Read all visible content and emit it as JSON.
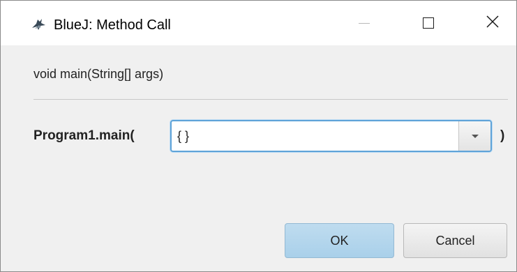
{
  "window": {
    "title": "BlueJ:  Method Call",
    "app_icon": "bluej-bird-icon",
    "controls": {
      "minimize": "minimize-icon",
      "maximize": "maximize-icon",
      "close": "close-icon",
      "close_glyph": "✕"
    }
  },
  "dialog": {
    "signature": "void main(String[] args)",
    "call_prefix": "Program1.main(",
    "argument_value": "{ }",
    "call_suffix": ")",
    "dropdown_icon": "chevron-down-icon"
  },
  "buttons": {
    "ok_label": "OK",
    "cancel_label": "Cancel"
  },
  "colors": {
    "focus_border": "#5fa3d8",
    "ok_button": "#a9d0ea",
    "dialog_bg": "#f0f0f0"
  }
}
